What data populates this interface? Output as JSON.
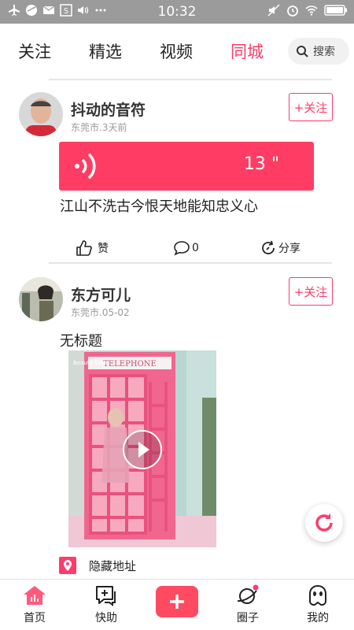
{
  "status_bar": {
    "time": "10:32"
  },
  "tabs": [
    {
      "label": "关注"
    },
    {
      "label": "精选"
    },
    {
      "label": "视频"
    },
    {
      "label": "同城"
    }
  ],
  "search": {
    "label": "搜索"
  },
  "posts": [
    {
      "author": "抖动的音符",
      "meta": "东莞市.3天前",
      "follow_label": "+关注",
      "voice_duration": "13 \"",
      "text": "江山不洗古今恨天地能知忠义心",
      "like_label": "赞",
      "comment_count": "0",
      "share_label": "分享"
    },
    {
      "author": "东方可儿",
      "meta": "东莞市.05-02",
      "follow_label": "+关注",
      "text": "无标题",
      "video_sign": "TELEPHONE",
      "video_watermark": "Beauty Cam",
      "location_label": "隐藏地址"
    }
  ],
  "bottom_nav": [
    {
      "label": "首页"
    },
    {
      "label": "快助"
    },
    {
      "label": "圈子"
    },
    {
      "label": "我的"
    }
  ],
  "colors": {
    "accent": "#ff3b6b",
    "voice_bg": "#ff3d64"
  }
}
